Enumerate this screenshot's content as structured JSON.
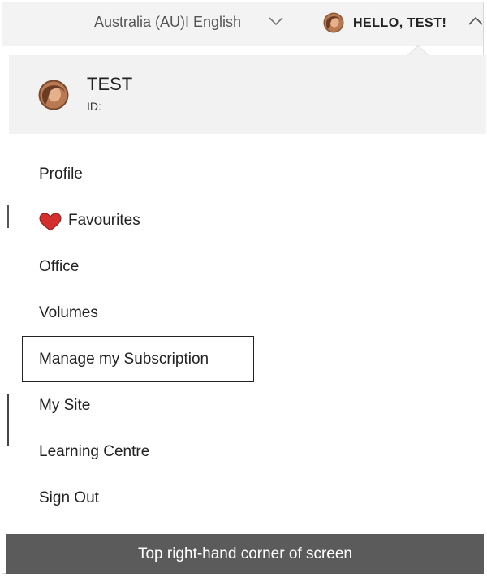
{
  "topbar": {
    "locale_label": "Australia (AU)I English",
    "greeting": "HELLO, TEST!",
    "icons": [
      "chevron-down-icon",
      "avatar",
      "chevron-up-icon"
    ]
  },
  "menu": {
    "header": {
      "name": "TEST",
      "id_label": "ID:"
    },
    "items": [
      {
        "label": "Profile"
      },
      {
        "label": "Favourites",
        "icon": "heart-icon"
      },
      {
        "label": "Office"
      },
      {
        "label": "Volumes"
      },
      {
        "label": "Manage my Subscription",
        "highlighted": true
      },
      {
        "label": "My Site"
      },
      {
        "label": "Learning Centre"
      },
      {
        "label": "Sign Out"
      }
    ]
  },
  "caption": "Top right-hand corner of screen",
  "colors": {
    "topbar_bg": "#f3f3f3",
    "header_bg": "#f2f2f2",
    "caption_bg": "#5b5b5b",
    "heart": "#d32f2f"
  }
}
